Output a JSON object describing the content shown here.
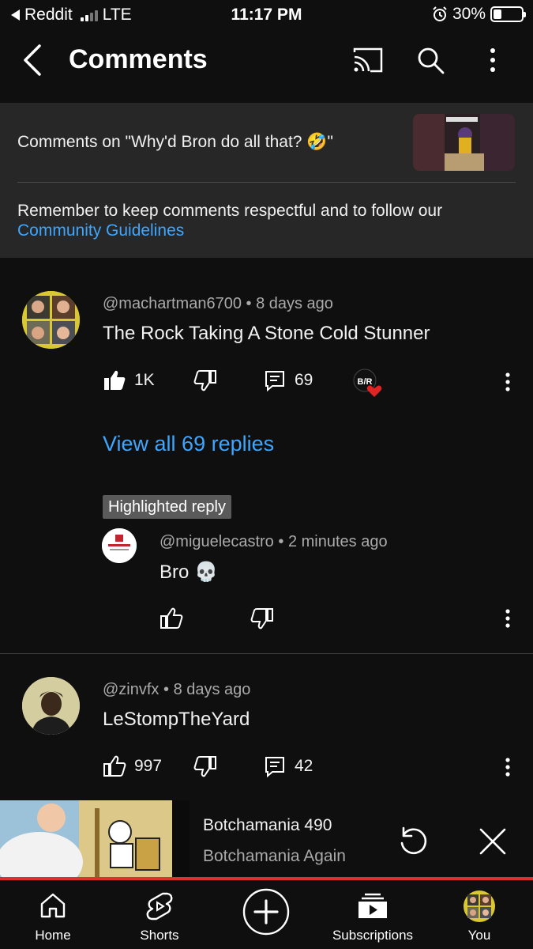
{
  "status_bar": {
    "back_app": "Reddit",
    "network": "LTE",
    "time": "11:17 PM",
    "battery": "30%",
    "battery_level": 0.3
  },
  "header": {
    "title": "Comments",
    "icons": [
      "back-chevron-icon",
      "cast-icon",
      "search-icon",
      "more-vertical-icon"
    ]
  },
  "context": {
    "comments_on": "Comments on \"Why'd Bron do all that? 🤣\"",
    "guidelines_text": "Remember to keep comments respectful and to follow our",
    "guidelines_link": "Community Guidelines"
  },
  "comments": [
    {
      "author": "@machartman6700",
      "time": "8 days ago",
      "text": "The Rock Taking A Stone Cold Stunner",
      "likes": "1K",
      "replies": "69",
      "creator_heart_badge": "B/R",
      "view_replies": "View all 69 replies",
      "highlighted_label": "Highlighted reply",
      "highlighted_reply": {
        "author": "@miguelecastro",
        "time": "2 minutes ago",
        "text": "Bro 💀"
      }
    },
    {
      "author": "@zinvfx",
      "time": "8 days ago",
      "text": "LeStompTheYard",
      "likes": "997",
      "replies": "42"
    }
  ],
  "mini_player": {
    "title": "Botchamania 490",
    "channel": "Botchamania Again"
  },
  "bottom_nav": {
    "home": "Home",
    "shorts": "Shorts",
    "subscriptions": "Subscriptions",
    "you": "You"
  },
  "colors": {
    "background": "#0f0f0f",
    "panel": "#272727",
    "link": "#3ea6ff",
    "progress": "#d9342b"
  }
}
